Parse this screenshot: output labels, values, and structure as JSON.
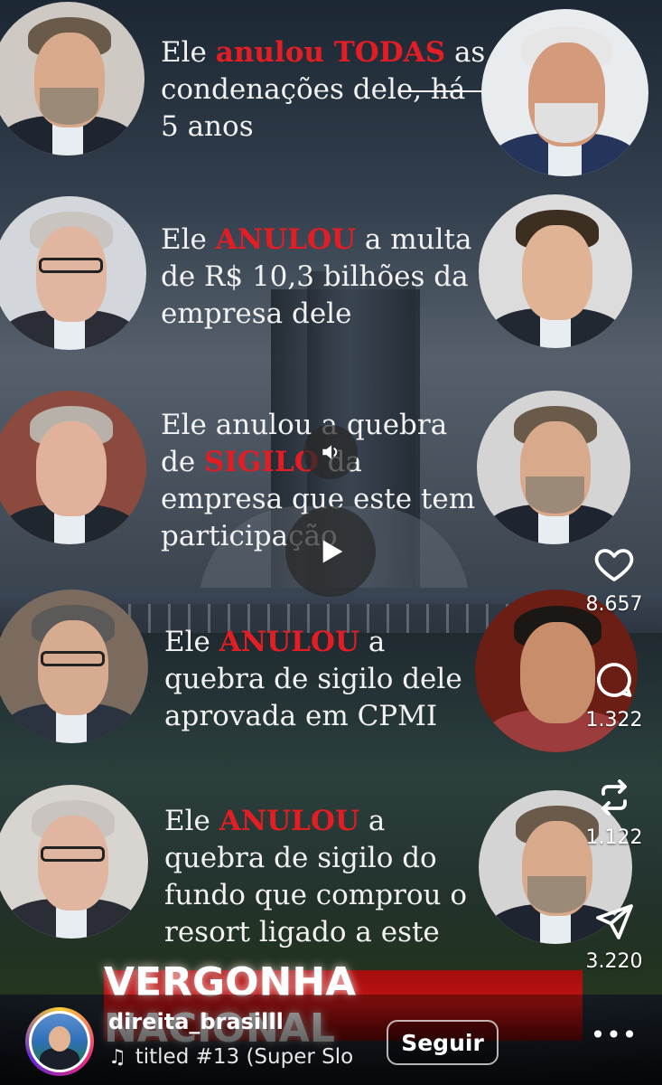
{
  "post": {
    "rows": [
      {
        "caption_pre": "Ele ",
        "caption_highlight": "anulou TODAS",
        "caption_post": " as condenações dele, há 5 anos",
        "left_person": "judge-portrait-1",
        "right_person": "politician-portrait-1"
      },
      {
        "caption_pre": "Ele ",
        "caption_highlight": "ANULOU",
        "caption_post": " a multa de R$ 10,3 bilhões da empresa dele",
        "left_person": "judge-portrait-2",
        "right_person": "businessman-portrait-1"
      },
      {
        "caption_pre": "Ele anulou a quebra de ",
        "caption_highlight": "SIGILO",
        "caption_post": " da empresa que este tem participação",
        "left_person": "judge-portrait-3",
        "right_person": "judge-portrait-1-alt"
      },
      {
        "caption_pre": "Ele ",
        "caption_highlight": "ANULOU",
        "caption_post": " a quebra de sigilo dele aprovada em CPMI",
        "left_person": "judge-portrait-4",
        "right_person": "man-portrait-1"
      },
      {
        "caption_pre": "Ele ",
        "caption_highlight": "ANULOU",
        "caption_post": " a quebra de sigilo do fundo que comprou o resort ligado a este",
        "left_person": "judge-portrait-2-alt",
        "right_person": "judge-portrait-1-alt2"
      }
    ],
    "banner": "VERGONHA NACIONAL"
  },
  "actions": {
    "likes": "8.657",
    "comments": "1.322",
    "reposts": "1.122",
    "shares": "3.220"
  },
  "footer": {
    "username": "direita_brasilll",
    "music": "titled #13 (Super Slo",
    "follow_label": "Seguir",
    "more_label": "•••"
  },
  "colors": {
    "highlight_red": "#e21d23",
    "banner_red": "#c21414"
  }
}
